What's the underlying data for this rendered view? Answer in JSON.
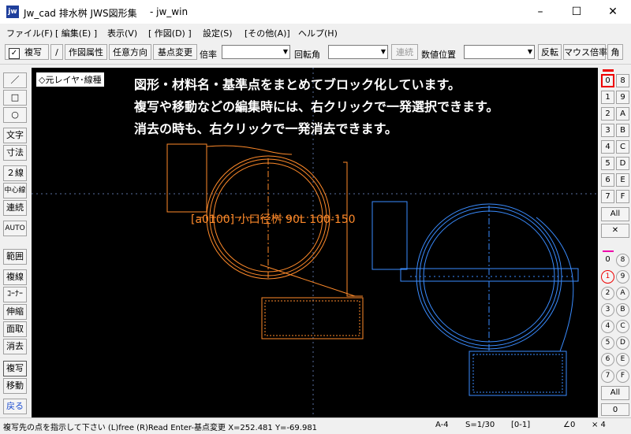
{
  "window": {
    "title": "Jw_cad 排水桝 JWS図形集",
    "subtitle": "- jw_win",
    "minimize": "–",
    "maximize": "☐",
    "close": "✕"
  },
  "menu": [
    "ファイル(F)",
    "[ 編集(E) ]",
    "表示(V)",
    "[ 作図(D) ]",
    "設定(S)",
    "[その他(A)]",
    "ヘルプ(H)"
  ],
  "toolbar": {
    "copy_check": "✓",
    "copy_label": "複写",
    "slash": "/",
    "attr": "作図属性",
    "dir": "任意方向",
    "base": "基点変更",
    "scale_label": "倍率",
    "scale_value": "",
    "rotate_label": "回転角",
    "rotate_value": "",
    "continuous": "連続",
    "pos_label": "数値位置",
    "pos_value": "",
    "flip": "反転",
    "mouse_scale": "マウス倍率",
    "corner": "角"
  },
  "left_tools": [
    "／",
    "□",
    "○",
    "文字",
    "寸法",
    "２線",
    "中心線",
    "連続",
    "AUTO",
    "範囲",
    "複線",
    "ｺｰﾅｰ",
    "伸縮",
    "面取",
    "消去",
    "複写",
    "移動",
    "戻る"
  ],
  "right_layer_groups": {
    "row_left": [
      "0",
      "1",
      "2",
      "3",
      "4",
      "5",
      "6",
      "7"
    ],
    "row_right": [
      "8",
      "9",
      "A",
      "B",
      "C",
      "D",
      "E",
      "F"
    ],
    "all": "All",
    "close": "✕"
  },
  "right_layers": {
    "row_left": [
      "0",
      "1",
      "2",
      "3",
      "4",
      "5",
      "6",
      "7"
    ],
    "row_right": [
      "8",
      "9",
      "A",
      "B",
      "C",
      "D",
      "E",
      "F"
    ],
    "all": "All",
    "bottom": "0"
  },
  "canvas": {
    "layer_tag": "◇元レイヤ･線種",
    "notes": [
      "図形・材料名・基準点をまとめてブロック化しています。",
      "複写や移動などの編集時には、右クリックで一発選択できます。",
      "消去の時も、右クリックで一発消去できます。"
    ],
    "block_label": "[a0100] 小口径桝 90L 100-150",
    "colors": {
      "orange": "#ff8a2a",
      "blue": "#3a8cff",
      "crosshair": "#5a6fa0"
    }
  },
  "status": {
    "message": "複写先の点を指示して下さい (L)free (R)Read  Enter-基点変更  X=252.481  Y=-69.981",
    "paper": "A-4",
    "scale": "S=1/30",
    "layer": "[0-1]",
    "angle": "∠0",
    "zoom": "× 4"
  }
}
